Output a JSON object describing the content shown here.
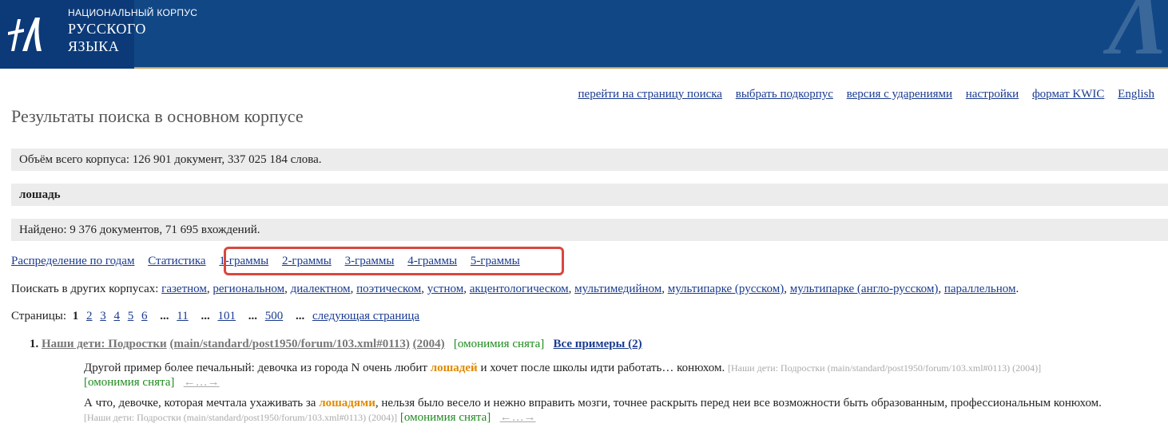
{
  "header": {
    "logo_line1": "НАЦИОНАЛЬНЫЙ КОРПУС",
    "logo_line2": "РУССКОГО",
    "logo_line3": "ЯЗЫКА"
  },
  "toplinks": [
    "перейти на страницу поиска",
    "выбрать подкорпус",
    "версия с ударениями",
    "настройки",
    "формат KWIC",
    "English"
  ],
  "page_title": "Результаты поиска в основном корпусе",
  "corpus_volume": "Объём всего корпуса: 126 901 документ, 337 025 184 слова.",
  "query": "лошадь",
  "found": "Найдено: 9 376 документов, 71 695 вхождений.",
  "analysis_links": [
    "Распределение по годам",
    "Статистика"
  ],
  "ngram_links": [
    "1-граммы",
    "2-граммы",
    "3-граммы",
    "4-граммы",
    "5-граммы"
  ],
  "other_corpora": {
    "label": "Поискать в других корпусах:",
    "items": [
      "газетном",
      "региональном",
      "диалектном",
      "поэтическом",
      "устном",
      "акцентологическом",
      "мультимедийном",
      "мультипарке (русском)",
      "мультипарке (англо-русском)",
      "параллельном"
    ]
  },
  "pages": {
    "label": "Страницы:",
    "current": "1",
    "items": [
      "2",
      "3",
      "4",
      "5",
      "6",
      "11",
      "101",
      "500"
    ],
    "ellipsis": "...",
    "next": "следующая страница"
  },
  "result": {
    "number": "1.",
    "source": "Наши дети: Подростки",
    "source_path": "(main/standard/post1950/forum/103.xml#0113)",
    "year": "(2004)",
    "homonymy": "[омонимия снята]",
    "all_examples": "Все примеры (2)",
    "examples": [
      {
        "before": "Другой пример более печальный: девочка из города N очень любит ",
        "hit": "лошадей",
        "after": " и хочет после школы идти работать… конюхом. ",
        "ref": "[Наши дети: Подростки (main/standard/post1950/forum/103.xml#0113) (2004)]",
        "homonymy": "[омонимия снята]",
        "arrows": "←…→"
      },
      {
        "before": "А что, девочке, которая мечтала ухаживать за ",
        "hit": "лошадями",
        "after": ", нельзя было весело и нежно вправить мозги, точнее раскрыть перед неи все возможности быть образованным, профессиональным конюхом. ",
        "ref": "[Наши дети: Подростки (main/standard/post1950/forum/103.xml#0113) (2004)]",
        "homonymy": "[омонимия снята]",
        "arrows": "←…→"
      }
    ]
  },
  "colors": {
    "header_bg": "#0c3a78",
    "header_gold": "#caa252",
    "link": "#1a3b8f",
    "hit": "#e08a00",
    "homonymy_green": "#1e8a1e",
    "highlight_box": "#d9473f"
  }
}
